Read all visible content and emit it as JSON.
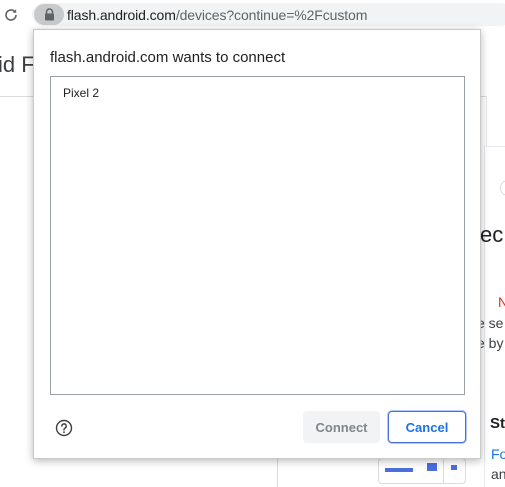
{
  "browser": {
    "url_host": "flash.android.com",
    "url_path": "/devices?continue=%2Fcustom",
    "reload_icon": "reload-icon",
    "lock_icon": "lock-icon"
  },
  "background_page": {
    "title_fragment": "id F",
    "heading_fragment": "ec",
    "red_text_fragment": "N",
    "text_line_1": "e se",
    "text_line_2": "e by",
    "subheading_fragment": "St",
    "link_fragment": "Fo",
    "text_line_3": "an"
  },
  "dialog": {
    "title": "flash.android.com wants to connect",
    "devices": [
      {
        "label": "Pixel 2"
      }
    ],
    "help_icon": "help-circle-icon",
    "connect_label": "Connect",
    "cancel_label": "Cancel"
  },
  "colors": {
    "accent": "#1a73e8",
    "disabled_text": "#80868b",
    "disabled_bg": "#f1f3f4",
    "error_red": "#d93025"
  }
}
